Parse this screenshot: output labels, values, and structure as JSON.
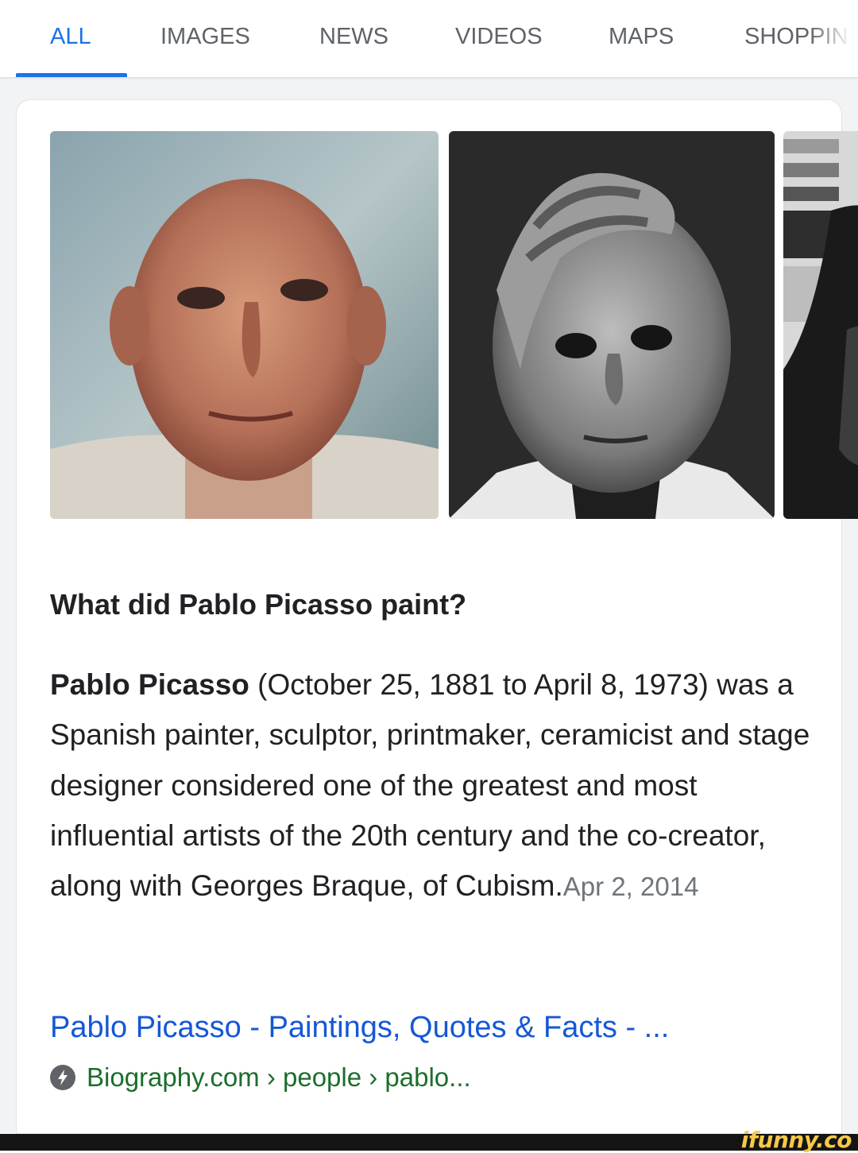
{
  "tabs": [
    {
      "label": "ALL",
      "active": true
    },
    {
      "label": "IMAGES",
      "active": false
    },
    {
      "label": "NEWS",
      "active": false
    },
    {
      "label": "VIDEOS",
      "active": false
    },
    {
      "label": "MAPS",
      "active": false
    },
    {
      "label": "SHOPPIN",
      "active": false
    }
  ],
  "images": [
    {
      "description_icon": "portrait-photo",
      "alt": "Pablo Picasso color portrait"
    },
    {
      "description_icon": "portrait-photo",
      "alt": "Pablo Picasso black and white portrait"
    },
    {
      "description_icon": "portrait-photo",
      "alt": "Pablo Picasso portrait (cropped)"
    }
  ],
  "result": {
    "question": "What did Pablo Picasso paint?",
    "answer_bold": "Pablo Picasso",
    "answer_text": " (October 25, 1881 to April 8, 1973) was a Spanish painter, sculptor, printmaker, ceramicist and stage designer considered one of the greatest and most influential artists of the 20th century and the co-creator, along with Georges Braque, of Cubism.",
    "date": "Apr 2, 2014",
    "source_title": "Pablo Picasso - Paintings, Quotes & Facts - ...",
    "source_url": "Biography.com › people › pablo...",
    "amp_icon": "amp-lightning-icon"
  },
  "watermark": "ifunny.co",
  "colors": {
    "accent": "#1a73e8",
    "link": "#1558d6",
    "url": "#1b6e2b",
    "text": "#202124"
  }
}
